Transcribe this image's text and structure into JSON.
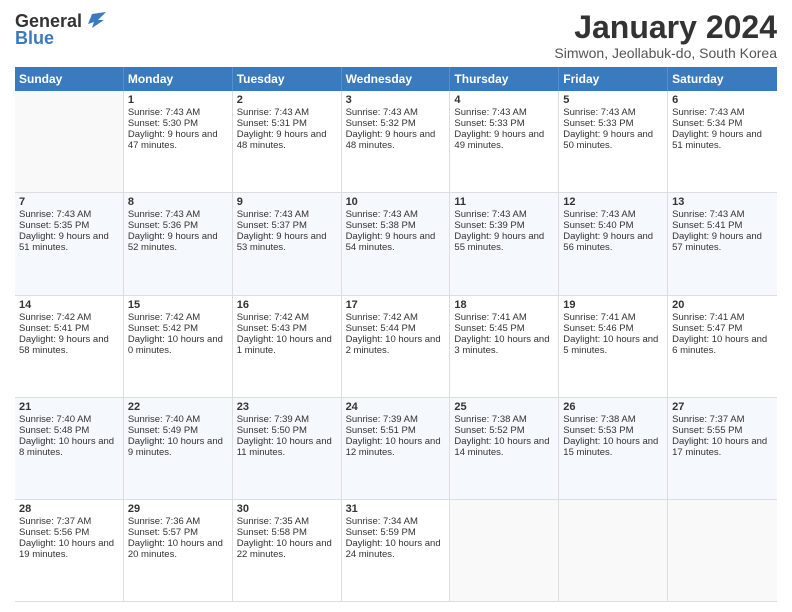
{
  "header": {
    "logo_general": "General",
    "logo_blue": "Blue",
    "title": "January 2024",
    "subtitle": "Simwon, Jeollabuk-do, South Korea"
  },
  "weekdays": [
    "Sunday",
    "Monday",
    "Tuesday",
    "Wednesday",
    "Thursday",
    "Friday",
    "Saturday"
  ],
  "weeks": [
    [
      {
        "day": "",
        "sunrise": "",
        "sunset": "",
        "daylight": ""
      },
      {
        "day": "1",
        "sunrise": "Sunrise: 7:43 AM",
        "sunset": "Sunset: 5:30 PM",
        "daylight": "Daylight: 9 hours and 47 minutes."
      },
      {
        "day": "2",
        "sunrise": "Sunrise: 7:43 AM",
        "sunset": "Sunset: 5:31 PM",
        "daylight": "Daylight: 9 hours and 48 minutes."
      },
      {
        "day": "3",
        "sunrise": "Sunrise: 7:43 AM",
        "sunset": "Sunset: 5:32 PM",
        "daylight": "Daylight: 9 hours and 48 minutes."
      },
      {
        "day": "4",
        "sunrise": "Sunrise: 7:43 AM",
        "sunset": "Sunset: 5:33 PM",
        "daylight": "Daylight: 9 hours and 49 minutes."
      },
      {
        "day": "5",
        "sunrise": "Sunrise: 7:43 AM",
        "sunset": "Sunset: 5:33 PM",
        "daylight": "Daylight: 9 hours and 50 minutes."
      },
      {
        "day": "6",
        "sunrise": "Sunrise: 7:43 AM",
        "sunset": "Sunset: 5:34 PM",
        "daylight": "Daylight: 9 hours and 51 minutes."
      }
    ],
    [
      {
        "day": "7",
        "sunrise": "Sunrise: 7:43 AM",
        "sunset": "Sunset: 5:35 PM",
        "daylight": "Daylight: 9 hours and 51 minutes."
      },
      {
        "day": "8",
        "sunrise": "Sunrise: 7:43 AM",
        "sunset": "Sunset: 5:36 PM",
        "daylight": "Daylight: 9 hours and 52 minutes."
      },
      {
        "day": "9",
        "sunrise": "Sunrise: 7:43 AM",
        "sunset": "Sunset: 5:37 PM",
        "daylight": "Daylight: 9 hours and 53 minutes."
      },
      {
        "day": "10",
        "sunrise": "Sunrise: 7:43 AM",
        "sunset": "Sunset: 5:38 PM",
        "daylight": "Daylight: 9 hours and 54 minutes."
      },
      {
        "day": "11",
        "sunrise": "Sunrise: 7:43 AM",
        "sunset": "Sunset: 5:39 PM",
        "daylight": "Daylight: 9 hours and 55 minutes."
      },
      {
        "day": "12",
        "sunrise": "Sunrise: 7:43 AM",
        "sunset": "Sunset: 5:40 PM",
        "daylight": "Daylight: 9 hours and 56 minutes."
      },
      {
        "day": "13",
        "sunrise": "Sunrise: 7:43 AM",
        "sunset": "Sunset: 5:41 PM",
        "daylight": "Daylight: 9 hours and 57 minutes."
      }
    ],
    [
      {
        "day": "14",
        "sunrise": "Sunrise: 7:42 AM",
        "sunset": "Sunset: 5:41 PM",
        "daylight": "Daylight: 9 hours and 58 minutes."
      },
      {
        "day": "15",
        "sunrise": "Sunrise: 7:42 AM",
        "sunset": "Sunset: 5:42 PM",
        "daylight": "Daylight: 10 hours and 0 minutes."
      },
      {
        "day": "16",
        "sunrise": "Sunrise: 7:42 AM",
        "sunset": "Sunset: 5:43 PM",
        "daylight": "Daylight: 10 hours and 1 minute."
      },
      {
        "day": "17",
        "sunrise": "Sunrise: 7:42 AM",
        "sunset": "Sunset: 5:44 PM",
        "daylight": "Daylight: 10 hours and 2 minutes."
      },
      {
        "day": "18",
        "sunrise": "Sunrise: 7:41 AM",
        "sunset": "Sunset: 5:45 PM",
        "daylight": "Daylight: 10 hours and 3 minutes."
      },
      {
        "day": "19",
        "sunrise": "Sunrise: 7:41 AM",
        "sunset": "Sunset: 5:46 PM",
        "daylight": "Daylight: 10 hours and 5 minutes."
      },
      {
        "day": "20",
        "sunrise": "Sunrise: 7:41 AM",
        "sunset": "Sunset: 5:47 PM",
        "daylight": "Daylight: 10 hours and 6 minutes."
      }
    ],
    [
      {
        "day": "21",
        "sunrise": "Sunrise: 7:40 AM",
        "sunset": "Sunset: 5:48 PM",
        "daylight": "Daylight: 10 hours and 8 minutes."
      },
      {
        "day": "22",
        "sunrise": "Sunrise: 7:40 AM",
        "sunset": "Sunset: 5:49 PM",
        "daylight": "Daylight: 10 hours and 9 minutes."
      },
      {
        "day": "23",
        "sunrise": "Sunrise: 7:39 AM",
        "sunset": "Sunset: 5:50 PM",
        "daylight": "Daylight: 10 hours and 11 minutes."
      },
      {
        "day": "24",
        "sunrise": "Sunrise: 7:39 AM",
        "sunset": "Sunset: 5:51 PM",
        "daylight": "Daylight: 10 hours and 12 minutes."
      },
      {
        "day": "25",
        "sunrise": "Sunrise: 7:38 AM",
        "sunset": "Sunset: 5:52 PM",
        "daylight": "Daylight: 10 hours and 14 minutes."
      },
      {
        "day": "26",
        "sunrise": "Sunrise: 7:38 AM",
        "sunset": "Sunset: 5:53 PM",
        "daylight": "Daylight: 10 hours and 15 minutes."
      },
      {
        "day": "27",
        "sunrise": "Sunrise: 7:37 AM",
        "sunset": "Sunset: 5:55 PM",
        "daylight": "Daylight: 10 hours and 17 minutes."
      }
    ],
    [
      {
        "day": "28",
        "sunrise": "Sunrise: 7:37 AM",
        "sunset": "Sunset: 5:56 PM",
        "daylight": "Daylight: 10 hours and 19 minutes."
      },
      {
        "day": "29",
        "sunrise": "Sunrise: 7:36 AM",
        "sunset": "Sunset: 5:57 PM",
        "daylight": "Daylight: 10 hours and 20 minutes."
      },
      {
        "day": "30",
        "sunrise": "Sunrise: 7:35 AM",
        "sunset": "Sunset: 5:58 PM",
        "daylight": "Daylight: 10 hours and 22 minutes."
      },
      {
        "day": "31",
        "sunrise": "Sunrise: 7:34 AM",
        "sunset": "Sunset: 5:59 PM",
        "daylight": "Daylight: 10 hours and 24 minutes."
      },
      {
        "day": "",
        "sunrise": "",
        "sunset": "",
        "daylight": ""
      },
      {
        "day": "",
        "sunrise": "",
        "sunset": "",
        "daylight": ""
      },
      {
        "day": "",
        "sunrise": "",
        "sunset": "",
        "daylight": ""
      }
    ]
  ]
}
